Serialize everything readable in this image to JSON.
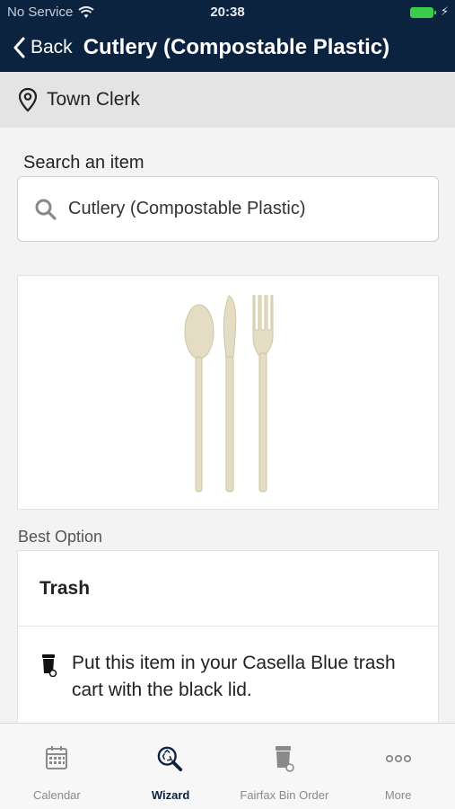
{
  "status_bar": {
    "carrier": "No Service",
    "time": "20:38"
  },
  "header": {
    "back_label": "Back",
    "title": "Cutlery (Compostable Plastic)"
  },
  "location": {
    "name": "Town Clerk"
  },
  "search": {
    "label": "Search an item",
    "value": "Cutlery (Compostable Plastic)"
  },
  "best_option": {
    "section_label": "Best Option",
    "title": "Trash",
    "description": "Put this item in your Casella Blue trash cart with the black lid."
  },
  "tabs": [
    {
      "label": "Calendar",
      "icon": "calendar-icon",
      "active": false
    },
    {
      "label": "Wizard",
      "icon": "wizard-search-icon",
      "active": true
    },
    {
      "label": "Fairfax Bin Order",
      "icon": "bin-icon",
      "active": false
    },
    {
      "label": "More",
      "icon": "more-icon",
      "active": false
    }
  ],
  "colors": {
    "header_bg": "#0c2340",
    "active_tab": "#0c2340",
    "battery": "#3ccc4c"
  }
}
